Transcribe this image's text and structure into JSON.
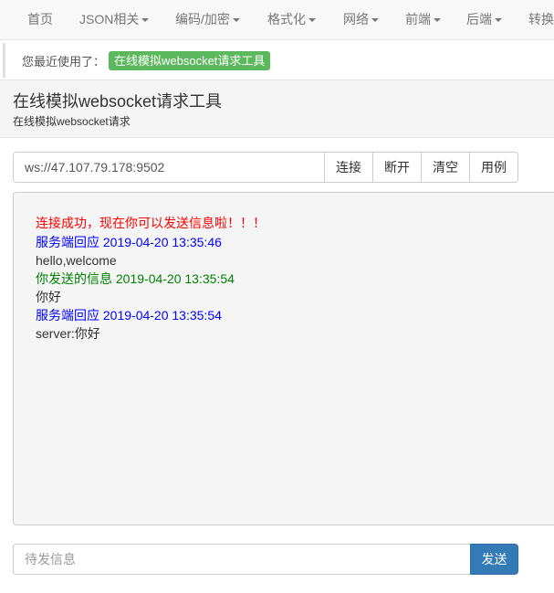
{
  "nav": {
    "items": [
      {
        "label": "首页",
        "dropdown": false
      },
      {
        "label": "JSON相关",
        "dropdown": true
      },
      {
        "label": "编码/加密",
        "dropdown": true
      },
      {
        "label": "格式化",
        "dropdown": true
      },
      {
        "label": "网络",
        "dropdown": true
      },
      {
        "label": "前端",
        "dropdown": true
      },
      {
        "label": "后端",
        "dropdown": true
      },
      {
        "label": "转换",
        "dropdown": false
      }
    ]
  },
  "recent": {
    "label": "您最近使用了：",
    "tool": "在线模拟websocket请求工具"
  },
  "page": {
    "title": "在线模拟websocket请求工具",
    "subtitle": "在线模拟websocket请求"
  },
  "controls": {
    "url": "ws://47.107.79.178:9502",
    "connect": "连接",
    "disconnect": "断开",
    "clear": "清空",
    "example": "用例"
  },
  "log": [
    {
      "text": "连接成功，现在你可以发送信息啦！！！",
      "type": "status"
    },
    {
      "text": "服务端回应 2019-04-20 13:35:46",
      "type": "server-header"
    },
    {
      "text": "hello,welcome",
      "type": "message"
    },
    {
      "text": "你发送的信息 2019-04-20 13:35:54",
      "type": "client-header"
    },
    {
      "text": "你好",
      "type": "message"
    },
    {
      "text": "服务端回应 2019-04-20 13:35:54",
      "type": "server-header"
    },
    {
      "text": "server:你好",
      "type": "message"
    }
  ],
  "send": {
    "placeholder": "待发信息",
    "button": "发送"
  },
  "colors": {
    "status": "#ff0000",
    "server": "#0000ff",
    "client": "#008000",
    "primary": "#337ab7",
    "success": "#5cb85c"
  }
}
